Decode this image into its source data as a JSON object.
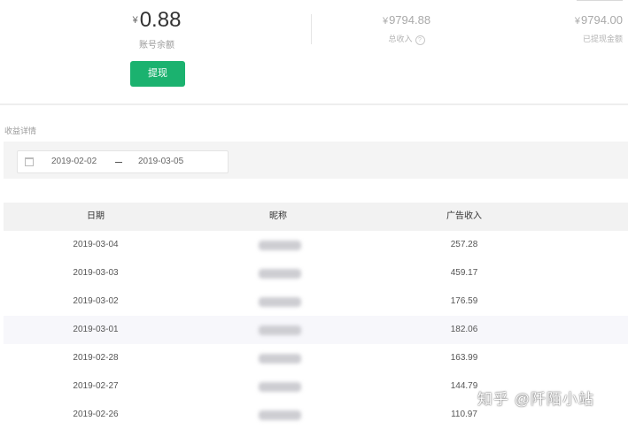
{
  "summary": {
    "balance": {
      "currency": "¥",
      "amount": "0.88",
      "label": "账号余额"
    },
    "withdraw_label": "提现",
    "total_income": {
      "currency": "¥",
      "amount": "9794.88",
      "label": "总收入",
      "help_icon": "?"
    },
    "withdrawn": {
      "currency": "¥",
      "amount": "9794.00",
      "label": "已提现金额"
    }
  },
  "details": {
    "title": "收益详情",
    "date_range": {
      "start": "2019-02-02",
      "end": "2019-03-05"
    }
  },
  "table": {
    "headers": {
      "date": "日期",
      "nickname": "昵称",
      "ad_income": "广告收入"
    },
    "rows": [
      {
        "date": "2019-03-04",
        "ad_income": "257.28"
      },
      {
        "date": "2019-03-03",
        "ad_income": "459.17"
      },
      {
        "date": "2019-03-02",
        "ad_income": "176.59"
      },
      {
        "date": "2019-03-01",
        "ad_income": "182.06"
      },
      {
        "date": "2019-02-28",
        "ad_income": "163.99"
      },
      {
        "date": "2019-02-27",
        "ad_income": "144.79"
      },
      {
        "date": "2019-02-26",
        "ad_income": "110.97"
      }
    ]
  },
  "watermark": "知乎 @阡陌小站",
  "colors": {
    "accent": "#1bb26f",
    "header_bg": "#f2f2f2",
    "alt_row_bg": "#f7f7fb"
  }
}
